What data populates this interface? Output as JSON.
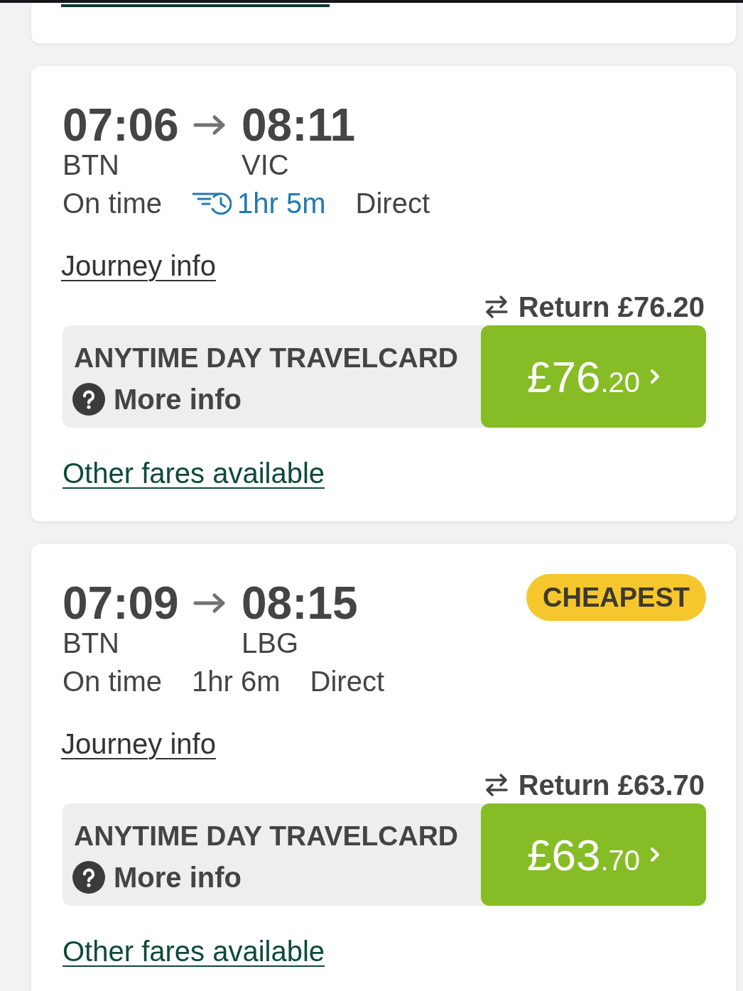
{
  "journeys": [
    {
      "depart_time": "07:06",
      "arrive_time": "08:11",
      "depart_station": "BTN",
      "arrive_station": "VIC",
      "status": "On time",
      "duration": "1hr 5m",
      "duration_highlighted": true,
      "changes": "Direct",
      "journey_link": "Journey info",
      "return_label": "Return £76.20",
      "fare_name": "ANYTIME DAY TRAVELCARD",
      "more_info": "More info",
      "price": {
        "pounds": "£76",
        "pence": ".20"
      },
      "other_fares_link": "Other fares available"
    },
    {
      "badge": "CHEAPEST",
      "depart_time": "07:09",
      "arrive_time": "08:15",
      "depart_station": "BTN",
      "arrive_station": "LBG",
      "status": "On time",
      "duration": "1hr 6m",
      "duration_highlighted": false,
      "changes": "Direct",
      "journey_link": "Journey info",
      "return_label": "Return £63.70",
      "fare_name": "ANYTIME DAY TRAVELCARD",
      "more_info": "More info",
      "price": {
        "pounds": "£63",
        "pence": ".70"
      },
      "other_fares_link": "Other fares available"
    }
  ]
}
